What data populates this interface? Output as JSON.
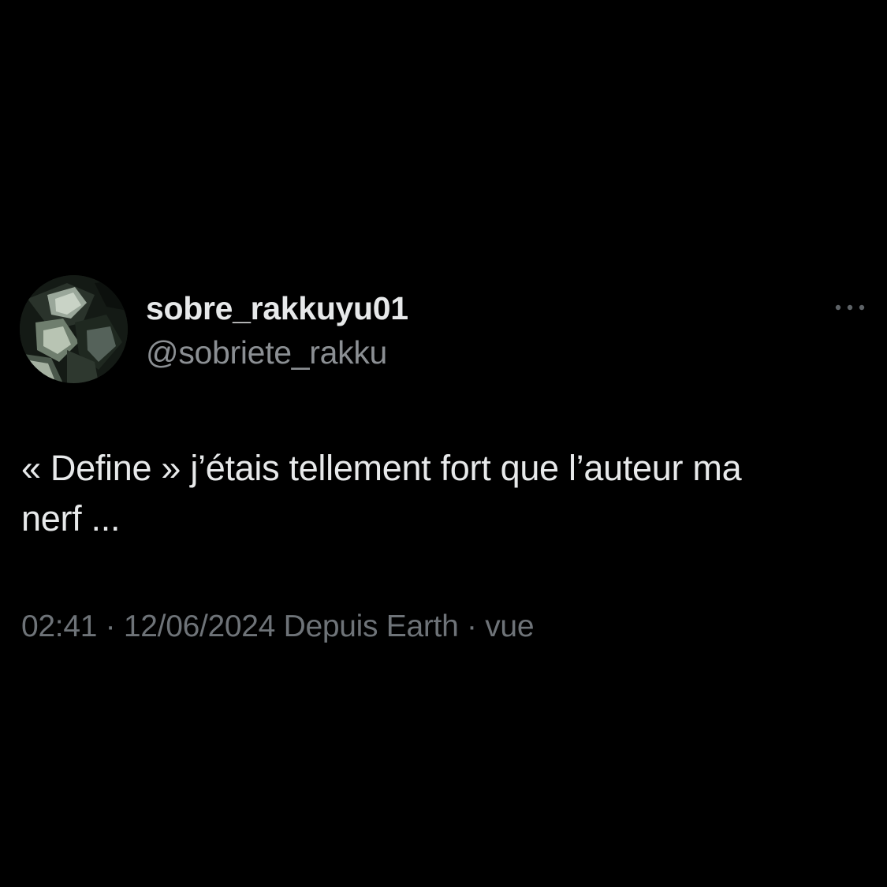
{
  "tweet": {
    "author": {
      "display_name": "sobre_rakkuyu01",
      "handle": "@sobriete_rakku",
      "avatar_icon": "profile-picture-manga-character"
    },
    "more_icon": "more-horizontal-icon",
    "text_line1": "« Define » j’étais tellement fort que l’auteur ma",
    "text_line2": "nerf ...",
    "meta": {
      "time": "02:41",
      "separator1": " · ",
      "date": "12/06/2024",
      "source": " Depuis Earth",
      "separator2": " · ",
      "views": "vue"
    }
  },
  "colors": {
    "background": "#000000",
    "primary_text": "#e7e9ea",
    "secondary_text": "#8b8f93",
    "meta_text": "#6e7378"
  }
}
